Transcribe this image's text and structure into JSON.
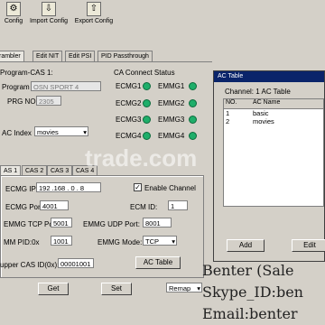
{
  "toolbar": {
    "config": "Config",
    "import": "Import Config",
    "export": "Export Config"
  },
  "tabs": [
    "rambler",
    "Edit NIT",
    "Edit PSI",
    "PID Passthrough"
  ],
  "program": {
    "header": "Program-CAS 1:",
    "program_label": "Program",
    "program_value": "OSN SPORT 4",
    "prg_no_label": "PRG NO.",
    "prg_no_value": "2305",
    "ac_index_label": "AC Index",
    "ac_index_value": "movies"
  },
  "status": {
    "title": "CA Connect Status",
    "ecmg": [
      "ECMG1",
      "ECMG2",
      "ECMG3",
      "ECMG4"
    ],
    "emmg": [
      "EMMG1",
      "EMMG2",
      "EMMG3",
      "EMMG4"
    ]
  },
  "cas_tabs": [
    "AS 1",
    "CAS 2",
    "CAS 3",
    "CAS 4"
  ],
  "cas": {
    "ecmg_ip_label": "ECMG IP:",
    "ecmg_ip_value": "192 .168 . 0 . 8",
    "enable_label": "Enable Channel",
    "ecmg_port_label": "ECMG Port:",
    "ecmg_port_value": "4001",
    "ecm_id_label": "ECM ID:",
    "ecm_id_value": "1",
    "emmg_tcp_label": "EMMG TCP Port:",
    "emmg_tcp_value": "5001",
    "emmg_udp_label": "EMMG UDP Port:",
    "emmg_udp_value": "8001",
    "emm_pid_label": "MM PID:0x",
    "emm_pid_value": "1001",
    "emmg_mode_label": "EMMG Mode:",
    "emmg_mode_value": "TCP",
    "supper_label": "upper CAS ID(0x):",
    "supper_value": "00001001",
    "ac_table_btn": "AC Table"
  },
  "buttons": {
    "get": "Get",
    "set": "Set",
    "remap": "Remap"
  },
  "ac_dialog": {
    "title": "AC Table",
    "channel_label": "Channel: 1 AC Table",
    "columns": [
      "NO.",
      "AC Name"
    ],
    "rows": [
      {
        "no": "1",
        "name": "basic"
      },
      {
        "no": "2",
        "name": "movies"
      }
    ],
    "add_btn": "Add",
    "edit_btn": "Edit"
  },
  "watermark": {
    "line1": "Benter (Sale",
    "line2": "Skype_ID:ben",
    "line3": "Email:benter",
    "trade": "trade.com"
  }
}
